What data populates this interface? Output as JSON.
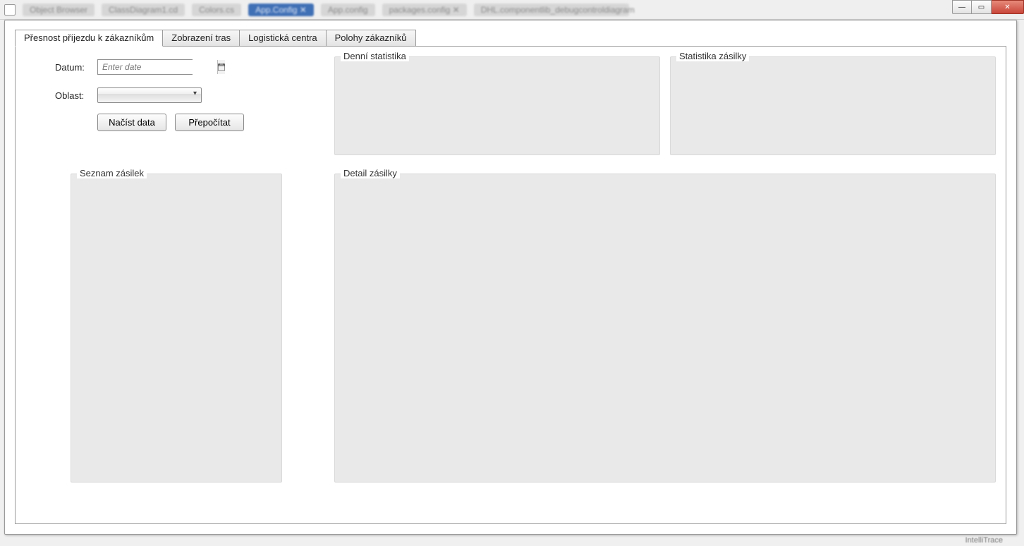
{
  "ide_tabs": [
    "Object Browser",
    "ClassDiagram1.cd",
    "Colors.cs",
    "App.Config ✕",
    "App.config",
    "packages.config ✕",
    "DHL.componentlib_debugcontroldiagram"
  ],
  "window_controls": {
    "minimize": "—",
    "maximize": "▭",
    "close": "✕"
  },
  "tabs": {
    "t1": "Přesnost příjezdu k zákazníkům",
    "t2": "Zobrazení tras",
    "t3": "Logistická centra",
    "t4": "Polohy zákazníků"
  },
  "form": {
    "date_label": "Datum:",
    "date_placeholder": "Enter date",
    "area_label": "Oblast:",
    "load_btn": "Načíst data",
    "recalc_btn": "Přepočítat"
  },
  "groups": {
    "daily_stats": "Denní statistika",
    "shipment_stats": "Statistika zásilky",
    "shipment_list": "Seznam zásilek",
    "shipment_detail": "Detail zásilky"
  },
  "footer": "IntelliTrace"
}
